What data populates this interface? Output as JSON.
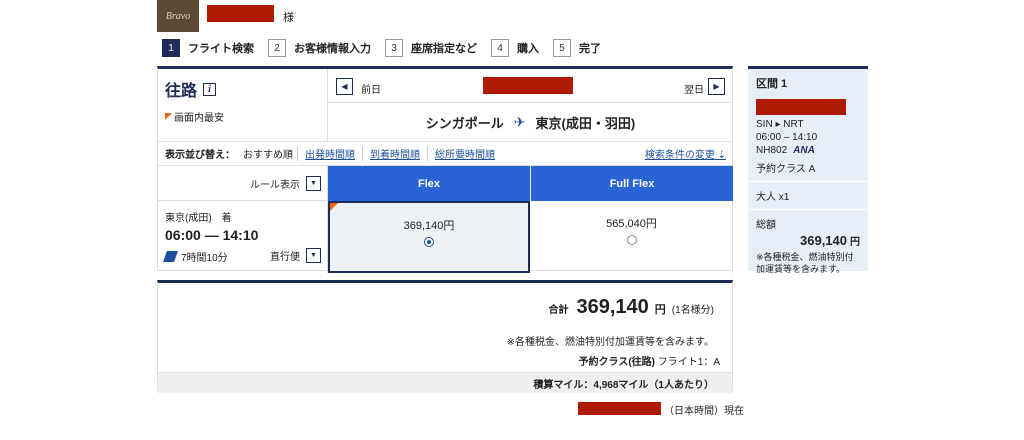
{
  "header": {
    "logo_text": "Bravo",
    "honorific": "様"
  },
  "steps": [
    {
      "num": "1",
      "label": "フライト検索"
    },
    {
      "num": "2",
      "label": "お客様情報入力"
    },
    {
      "num": "3",
      "label": "座席指定など"
    },
    {
      "num": "4",
      "label": "購入"
    },
    {
      "num": "5",
      "label": "完了"
    }
  ],
  "flight_panel": {
    "title": "往路",
    "info_icon": "i",
    "cheapest_label": "画面内最安",
    "prev_label": "前日",
    "next_label": "翌日",
    "prev_arrow": "◀",
    "next_arrow": "▶",
    "origin": "シンガポール",
    "destination": "東京(成田・羽田)",
    "plane_icon": "✈"
  },
  "sort": {
    "label": "表示並び替え：",
    "current": "おすすめ順",
    "options": [
      "出発時間順",
      "到着時間順",
      "総所要時間順"
    ],
    "conditions_link": "検索条件の変更",
    "conditions_icon": "⇣"
  },
  "fares": {
    "rule_label": "ルール表示",
    "dd_arrow": "▼",
    "flex_label": "Flex",
    "full_flex_label": "Full Flex",
    "flex_price": "369,140円",
    "full_flex_price": "565,040円",
    "selected": "flex"
  },
  "flight": {
    "arrival": "東京(成田)　着",
    "times": "06:00 — 14:10",
    "duration": "7時間10分",
    "direct": "直行便"
  },
  "total": {
    "label": "合計",
    "amount": "369,140",
    "yen": "円",
    "per": "(1名様分)",
    "note": "※各種税金、燃油特別付加運賃等を含みます。",
    "class_label": "予約クラス(往路)",
    "class_value": "フライト1：A",
    "miles": "積算マイル：4,968マイル（1人あたり）"
  },
  "now": "（日本時間）現在",
  "sidebar": {
    "section_title": "区間 1",
    "route": "SIN ▸ NRT",
    "times": "06:00 – 14:10",
    "flight_no": "NH802",
    "airline": "ANA",
    "booking_class": "予約クラス A",
    "pax": "大人 x1",
    "sum_label": "総額",
    "sum": "369,140",
    "sum_yen": "円",
    "note": "※各種税金、燃油特別付加運賃等を含みます。"
  }
}
